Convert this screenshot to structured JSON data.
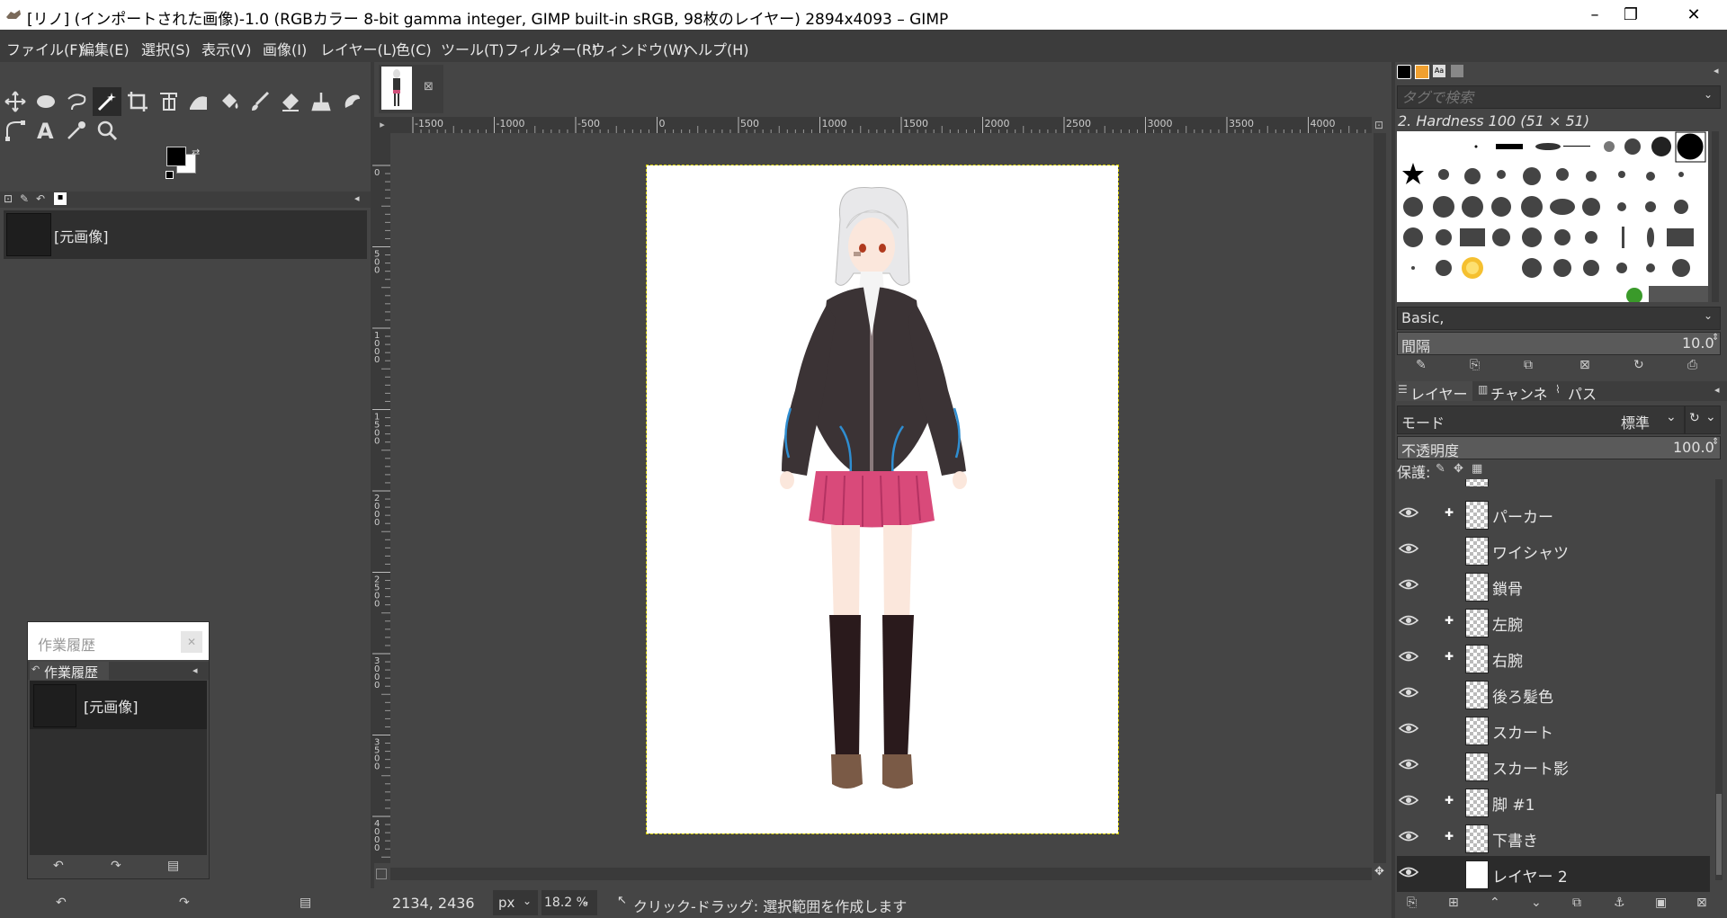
{
  "window": {
    "title": "[リノ] (インポートされた画像)-1.0 (RGBカラー 8-bit gamma integer, GIMP built-in sRGB, 98枚のレイヤー) 2894x4093 – GIMP",
    "minimize": "–",
    "maximize": "❐",
    "close": "✕"
  },
  "menubar": [
    "ファイル(F)",
    "編集(E)",
    "選択(S)",
    "表示(V)",
    "画像(I)",
    "レイヤー(L)",
    "色(C)",
    "ツール(T)",
    "フィルター(R)",
    "ウィンドウ(W)",
    "ヘルプ(H)"
  ],
  "toolbox": {
    "tools": [
      "move-tool",
      "ellipse-select-tool",
      "free-select-tool",
      "fuzzy-select-tool",
      "crop-tool",
      "unified-transform-tool",
      "warp-transform-tool",
      "bucket-fill-tool",
      "paintbrush-tool",
      "eraser-tool",
      "clone-tool",
      "smudge-tool",
      "paths-tool",
      "text-tool",
      "color-picker-tool",
      "zoom-tool"
    ],
    "fg_color": "#000000",
    "bg_color": "#ffffff"
  },
  "undo_history": {
    "item": "[元画像]"
  },
  "floating_history": {
    "title": "作業履歴",
    "tab_label": "作業履歴",
    "item": "[元画像]"
  },
  "canvas": {
    "ruler_labels": [
      "-1500",
      "-1000",
      "-500",
      "0",
      "500",
      "1000",
      "1500",
      "2000",
      "2500",
      "3000",
      "3500",
      "4000"
    ],
    "vruler_labels": [
      "0",
      "500",
      "1000",
      "1500",
      "2000",
      "2500",
      "3000",
      "3500",
      "4000"
    ]
  },
  "status": {
    "coords": "2134, 2436",
    "unit": "px",
    "zoom": "18.2 %",
    "message": "クリック-ドラッグ: 選択範囲を作成します"
  },
  "brushes": {
    "search_placeholder": "タグで検索",
    "selected_brush": "2. Hardness 100 (51 × 51)",
    "preset": "Basic,",
    "spacing_label": "間隔",
    "spacing_value": "10.0"
  },
  "layers_panel": {
    "tabs": [
      "レイヤー",
      "チャンネル",
      "パス"
    ],
    "mode_label": "モード",
    "mode_value": "標準",
    "opacity_label": "不透明度",
    "opacity_value": "100.0",
    "lock_label": "保護:",
    "layers": [
      {
        "name": "パーカー",
        "chain": true
      },
      {
        "name": "ワイシャツ",
        "chain": false
      },
      {
        "name": "鎖骨",
        "chain": false
      },
      {
        "name": "左腕",
        "chain": true
      },
      {
        "name": "右腕",
        "chain": true
      },
      {
        "name": "後ろ髪色",
        "chain": false
      },
      {
        "name": "スカート",
        "chain": false
      },
      {
        "name": "スカート影",
        "chain": false
      },
      {
        "name": "脚 #1",
        "chain": true
      },
      {
        "name": "下書き",
        "chain": true
      },
      {
        "name": "レイヤー 2",
        "chain": false
      }
    ]
  }
}
